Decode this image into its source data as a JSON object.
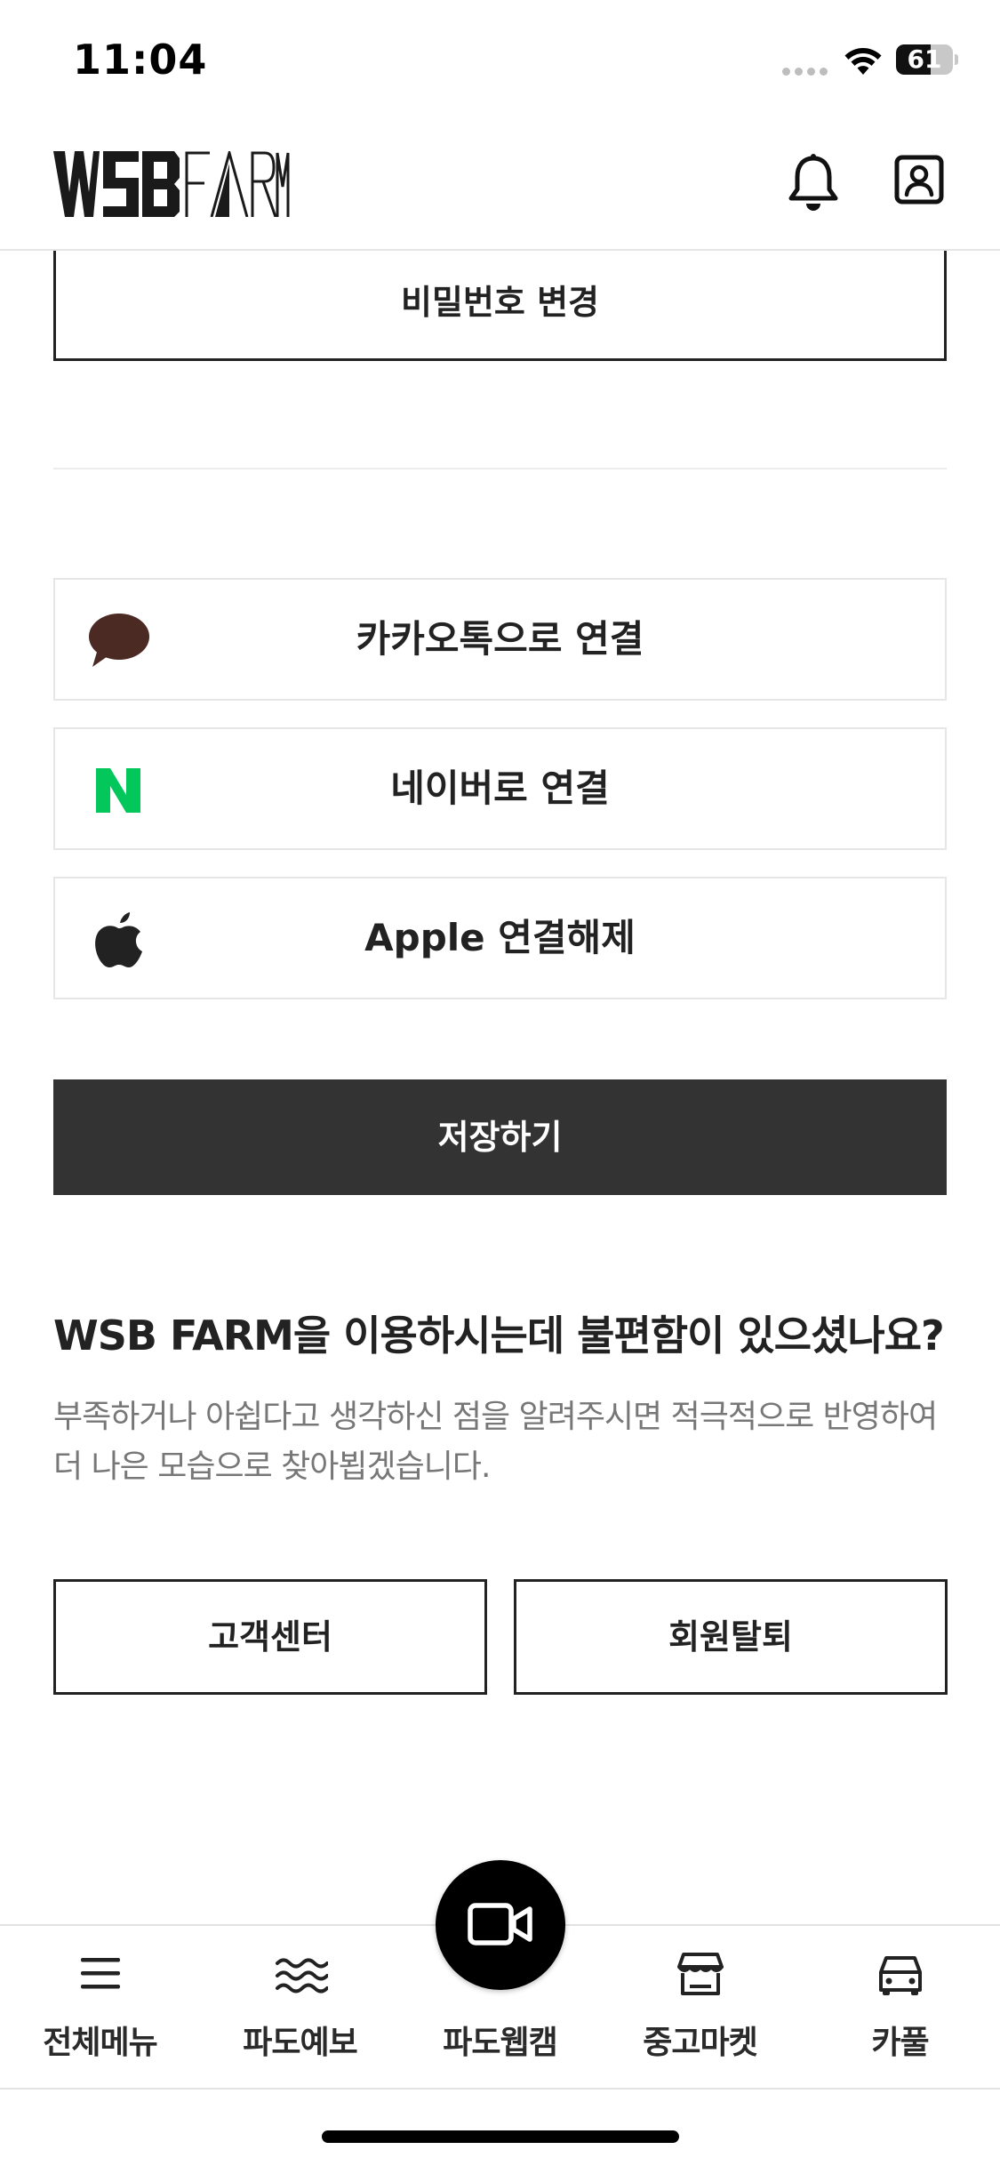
{
  "status_bar": {
    "time": "11:04",
    "battery_level": "61",
    "battery_fraction": 0.61
  },
  "header": {
    "logo_text": "WSB FARM",
    "icons": {
      "notification": "bell-icon",
      "profile": "profile-icon"
    }
  },
  "account": {
    "change_password_label": "비밀번호 변경",
    "social": [
      {
        "label": "카카오톡으로 연결",
        "icon": "kakao-talk-icon",
        "color": "#4a2a22"
      },
      {
        "label": "네이버로 연결",
        "icon": "naver-icon",
        "color": "#03c75a"
      },
      {
        "label": "Apple 연결해제",
        "icon": "apple-icon",
        "color": "#222222"
      }
    ],
    "save_label": "저장하기"
  },
  "feedback": {
    "title": "WSB FARM을 이용하시는데 불편함이 있으셨나요?",
    "description": "부족하거나 아쉽다고 생각하신 점을 알려주시면 적극적으로 반영하여 더 나은 모습으로 찾아뵙겠습니다.",
    "customer_center_label": "고객센터",
    "withdraw_label": "회원탈퇴"
  },
  "bottom_nav": {
    "items": [
      {
        "label": "전체메뉴",
        "icon": "menu-icon"
      },
      {
        "label": "파도예보",
        "icon": "waves-icon"
      },
      {
        "label": "파도웹캠",
        "icon": "video-camera-icon"
      },
      {
        "label": "중고마켓",
        "icon": "store-icon"
      },
      {
        "label": "카풀",
        "icon": "car-icon"
      }
    ]
  },
  "colors": {
    "primary_dark": "#333333",
    "text": "#222222",
    "muted_text": "#777777",
    "border": "#e6e6e6"
  }
}
